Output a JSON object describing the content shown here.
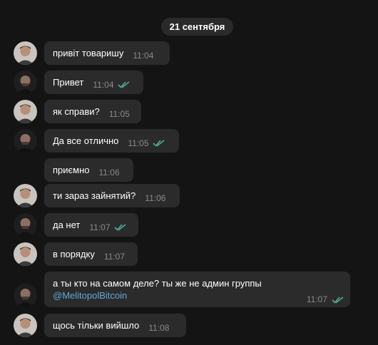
{
  "date_label": "21 сентября",
  "colors": {
    "bubble": "#2b2b2b",
    "link": "#5fa8dd",
    "tick": "#4fae9c",
    "time": "#8a8a8a"
  },
  "messages": [
    {
      "sender": "user-a",
      "text": "привіт товаришу",
      "time": "11:04",
      "read_ticks": false
    },
    {
      "sender": "user-b",
      "text": "Привет",
      "time": "11:04",
      "read_ticks": true
    },
    {
      "sender": "user-a",
      "text": "як справи?",
      "time": "11:05",
      "read_ticks": false
    },
    {
      "sender": "user-b",
      "text": "Да все отлично",
      "time": "11:05",
      "read_ticks": true
    },
    {
      "sender": "user-a",
      "text": "приємно",
      "time": "11:06",
      "read_ticks": false
    },
    {
      "sender": "user-a",
      "text": "ти зараз зайнятий?",
      "time": "11:06",
      "read_ticks": false
    },
    {
      "sender": "user-b",
      "text": "да нет",
      "time": "11:07",
      "read_ticks": true
    },
    {
      "sender": "user-a",
      "text": "в порядку",
      "time": "11:07",
      "read_ticks": false
    },
    {
      "sender": "user-b",
      "text": "а ты кто на самом деле? ты же не админ группы",
      "link": "@MelitopolBitcoin",
      "time": "11:07",
      "read_ticks": true
    },
    {
      "sender": "user-a",
      "text": "щось тільки вийшло",
      "time": "11:08",
      "read_ticks": false
    }
  ]
}
